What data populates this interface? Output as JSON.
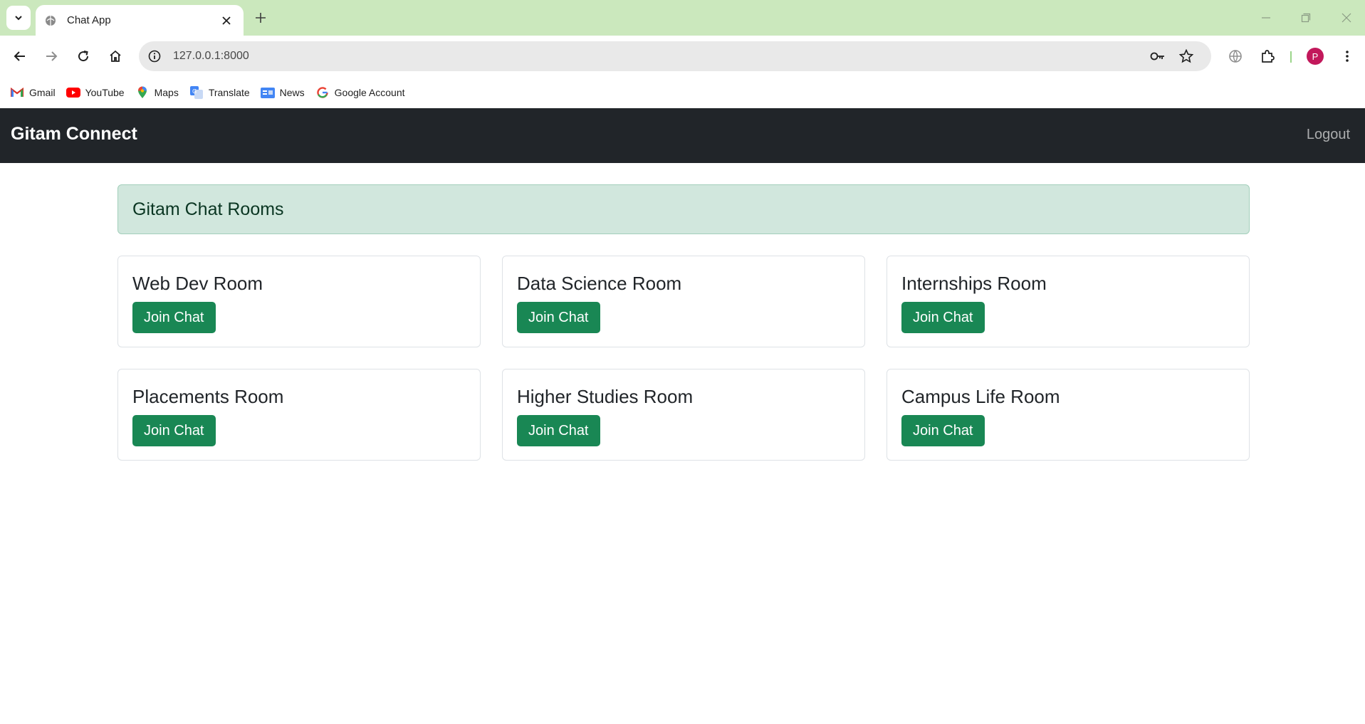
{
  "browser": {
    "tab_title": "Chat App",
    "url": "127.0.0.1:8000",
    "profile_initial": "P",
    "bookmarks": [
      {
        "label": "Gmail",
        "icon": "gmail-icon"
      },
      {
        "label": "YouTube",
        "icon": "youtube-icon"
      },
      {
        "label": "Maps",
        "icon": "maps-icon"
      },
      {
        "label": "Translate",
        "icon": "translate-icon"
      },
      {
        "label": "News",
        "icon": "news-icon"
      },
      {
        "label": "Google Account",
        "icon": "google-icon"
      }
    ]
  },
  "navbar": {
    "brand": "Gitam Connect",
    "logout": "Logout"
  },
  "main": {
    "banner_title": "Gitam Chat Rooms",
    "rooms": [
      {
        "name": "Web Dev Room",
        "button": "Join Chat"
      },
      {
        "name": "Data Science Room",
        "button": "Join Chat"
      },
      {
        "name": "Internships Room",
        "button": "Join Chat"
      },
      {
        "name": "Placements Room",
        "button": "Join Chat"
      },
      {
        "name": "Higher Studies Room",
        "button": "Join Chat"
      },
      {
        "name": "Campus Life Room",
        "button": "Join Chat"
      }
    ]
  },
  "colors": {
    "navbar_bg": "#212529",
    "banner_bg": "#d1e7dd",
    "button_bg": "#198754",
    "tabstrip_bg": "#cbe8bd"
  }
}
